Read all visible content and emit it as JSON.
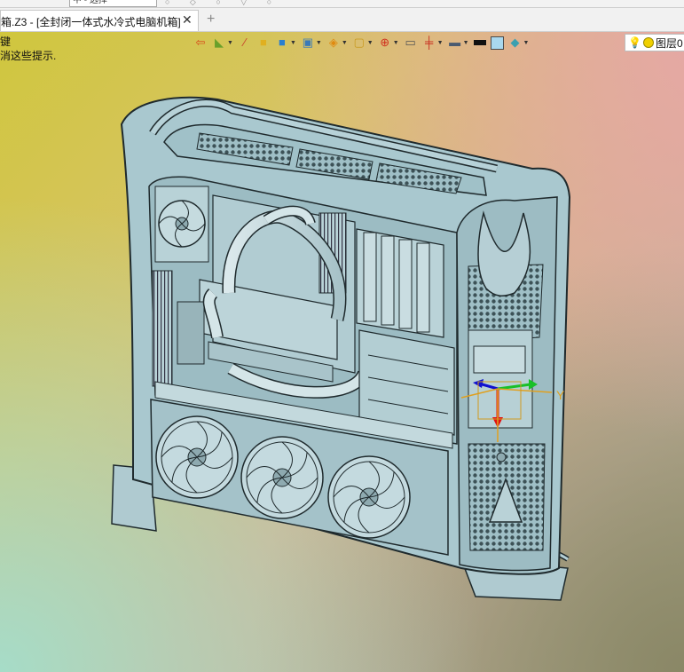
{
  "top_strip": {
    "field_value": "中 - 选择"
  },
  "tab": {
    "title": "箱.Z3 - [全封闭一体式水冷式电脑机箱]",
    "close_glyph": "✕",
    "new_tab_glyph": "+"
  },
  "prompt": {
    "line1": "键",
    "line2": "消这些提示."
  },
  "toolbar": {
    "icons": [
      "import-icon",
      "paint-bucket-icon",
      "brush-icon",
      "box-icon",
      "solid-cube-icon",
      "component-icon",
      "shading-icon",
      "view-frame-icon",
      "origin-icon",
      "layout-icon",
      "dimension-icon",
      "monitor-icon",
      "line-color-icon",
      "fill-color-icon",
      "layer-stack-icon"
    ]
  },
  "layer": {
    "label": "图层0"
  },
  "triad": {
    "y_label": "Y"
  },
  "colors": {
    "accent_blue": "#a9d8ee",
    "part_fill": "#a9c8cf",
    "part_edge": "#1f2a2d",
    "tab_bg": "#ffffff"
  }
}
